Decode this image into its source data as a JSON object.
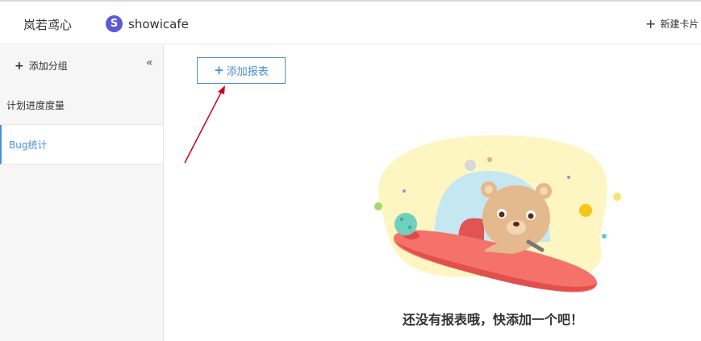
{
  "header": {
    "brand": "岚若鸢心",
    "project_initial": "S",
    "project_name": "showicafe",
    "new_card": "新建卡片"
  },
  "sidebar": {
    "add_group": "添加分组",
    "collapse_glyph": "«",
    "items": [
      {
        "label": "计划进度度量",
        "active": false
      },
      {
        "label": "Bug统计",
        "active": true
      }
    ]
  },
  "main": {
    "add_report": "添加报表",
    "empty_message": "还没有报表哦，快添加一个吧！"
  },
  "colors": {
    "accent": "#4a90d9",
    "avatar": "#5b5bd6",
    "arrow": "#d0021b"
  }
}
